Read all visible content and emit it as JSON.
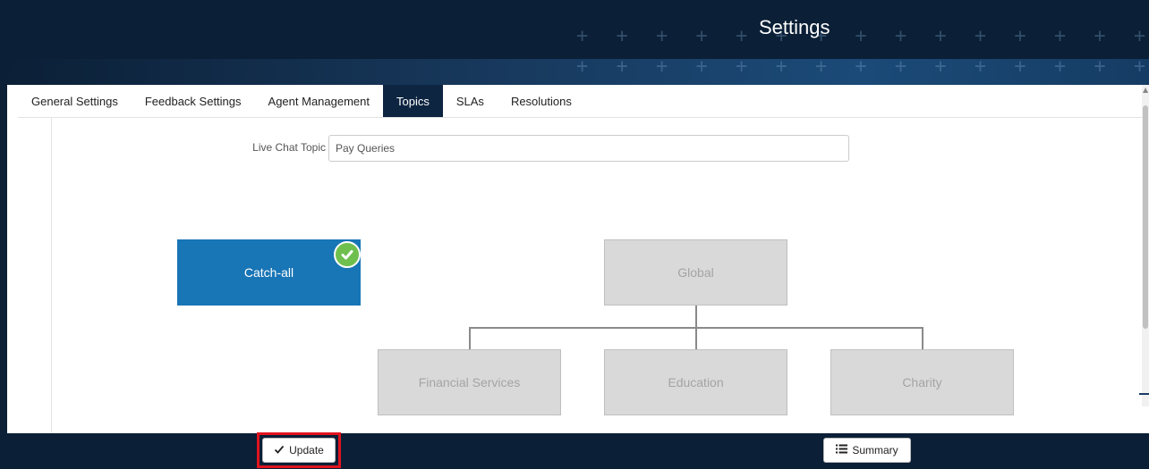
{
  "header": {
    "title": "Settings"
  },
  "tabs": [
    {
      "label": "General Settings"
    },
    {
      "label": "Feedback Settings"
    },
    {
      "label": "Agent Management"
    },
    {
      "label": "Topics",
      "active": true
    },
    {
      "label": "SLAs"
    },
    {
      "label": "Resolutions"
    }
  ],
  "live_chat_topic": {
    "label": "Live Chat Topic",
    "value": "Pay Queries"
  },
  "topics": {
    "catch_all": {
      "label": "Catch-all",
      "selected": true
    },
    "root": {
      "label": "Global"
    },
    "children": [
      {
        "label": "Financial Services"
      },
      {
        "label": "Education"
      },
      {
        "label": "Charity"
      }
    ]
  },
  "footer": {
    "update_label": "Update",
    "summary_label": "Summary"
  },
  "colors": {
    "header_bg": "#0b1f36",
    "active_tab": "#0e2541",
    "selected_topic": "#1875b6",
    "inactive_topic": "#d9d9d9",
    "check_badge": "#6fbf4e",
    "highlight": "#e0141e"
  },
  "icons": {
    "check": "check-icon",
    "list": "list-icon",
    "badge": "check-circle-icon"
  }
}
